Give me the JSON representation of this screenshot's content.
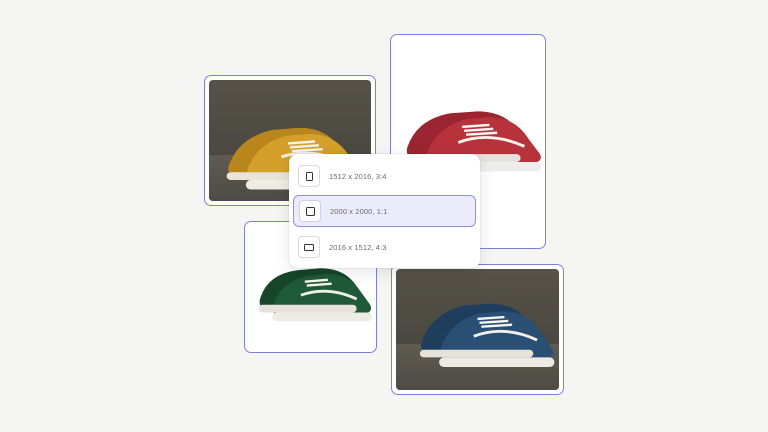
{
  "gallery": {
    "images": [
      {
        "name": "yellow-sneaker",
        "colors": {
          "body": "#d5a02a",
          "shade": "#b9851d"
        }
      },
      {
        "name": "red-sneaker",
        "colors": {
          "body": "#b8323c",
          "shade": "#9a2530"
        }
      },
      {
        "name": "green-sneaker",
        "colors": {
          "body": "#1f5a38",
          "shade": "#16452a"
        }
      },
      {
        "name": "blue-sneaker",
        "colors": {
          "body": "#2a4f74",
          "shade": "#1f3d5c"
        }
      }
    ],
    "accent_border": "#7b80e0"
  },
  "ratio_menu": {
    "options": [
      {
        "label": "1512 x 2016, 3:4",
        "icon": "portrait-frame-icon",
        "selected": false
      },
      {
        "label": "2000 x 2000, 1:1",
        "icon": "square-frame-icon",
        "selected": true
      },
      {
        "label": "2016 x 1512, 4:3",
        "icon": "landscape-frame-icon",
        "selected": false
      }
    ],
    "selected_color": "#ecebfb"
  }
}
